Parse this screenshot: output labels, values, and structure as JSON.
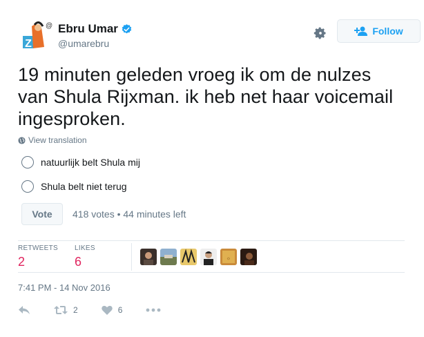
{
  "user": {
    "display_name": "Ebru Umar",
    "handle": "@umarebru",
    "verified": true
  },
  "header": {
    "follow_label": "Follow",
    "settings_icon": "gear-icon"
  },
  "tweet": {
    "text": "19 minuten geleden vroeg ik om de nulzes van Shula Rijxman. ik heb net haar voicemail ingesproken.",
    "translate_label": "View translation"
  },
  "poll": {
    "options": [
      {
        "label": "natuurlijk belt Shula mij"
      },
      {
        "label": "Shula belt niet terug"
      }
    ],
    "vote_label": "Vote",
    "meta": "418 votes • 44 minutes left"
  },
  "stats": {
    "retweets_label": "RETWEETS",
    "retweets_value": "2",
    "likes_label": "LIKES",
    "likes_value": "6"
  },
  "timestamp": "7:41 PM - 14 Nov 2016",
  "actions": {
    "reply_icon": "reply-icon",
    "retweet_count": "2",
    "like_count": "6",
    "more_icon": "more-icon"
  },
  "colors": {
    "accent": "#1da1f2",
    "like": "#e0245e",
    "muted": "#657786"
  }
}
